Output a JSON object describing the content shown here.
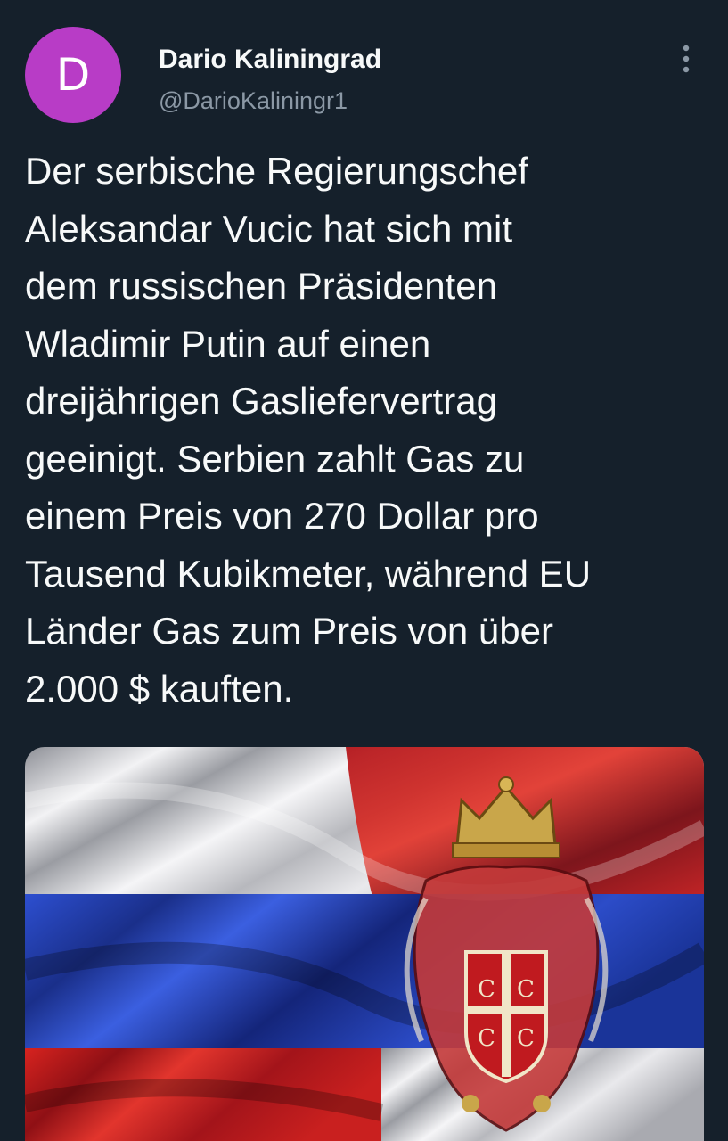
{
  "tweet": {
    "author": {
      "avatar_letter": "D",
      "avatar_color": "#b83cc6",
      "display_name": "Dario Kaliningrad",
      "handle": "@DarioKaliningr1"
    },
    "more_icon": "more-vertical-icon",
    "text": "Der serbische Regierungschef\nAleksandar Vucic hat sich mit\ndem russischen Präsidenten\nWladimir Putin auf einen\ndreijährigen Gasliefervertrag\ngeeinigt. Serbien zahlt Gas zu\neinem Preis von 270 Dollar pro\nTausend Kubikmeter, während EU\nLänder Gas zum Preis von über\n2.000 $ kauften.",
    "media": {
      "description_icon": "flag-image",
      "colors": {
        "white": "#e9e9ec",
        "blue": "#1f3fb0",
        "red": "#c4181f",
        "dark_red": "#7d0f17"
      }
    }
  },
  "theme": {
    "background": "#15202b",
    "text": "#f7f9f9",
    "secondary_text": "#8b98a5"
  }
}
